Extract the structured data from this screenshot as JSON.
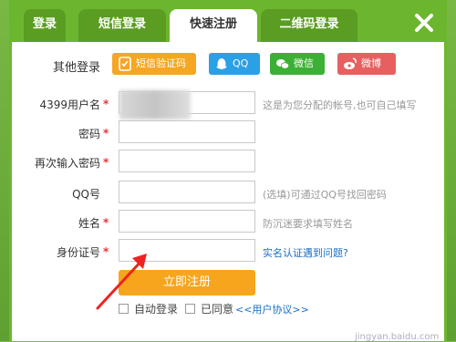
{
  "tabs": [
    {
      "label": "登录",
      "active": false
    },
    {
      "label": "短信登录",
      "active": false
    },
    {
      "label": "快速注册",
      "active": true
    },
    {
      "label": "二维码登录",
      "active": false
    }
  ],
  "close_icon": "close-icon",
  "other_login": {
    "label": "其他登录",
    "buttons": [
      {
        "label": "短信验证码",
        "icon": "sms-icon",
        "color": "#f5a623"
      },
      {
        "label": "QQ",
        "icon": "qq-icon",
        "color": "#2aa0e6"
      },
      {
        "label": "微信",
        "icon": "wechat-icon",
        "color": "#3cb034"
      },
      {
        "label": "微博",
        "icon": "weibo-icon",
        "color": "#e85f5f"
      }
    ]
  },
  "form": {
    "username": {
      "label": "4399用户名",
      "hint": "这是为您分配的帐号,也可自己填写",
      "required": true
    },
    "password": {
      "label": "密码",
      "required": true
    },
    "confirm_password": {
      "label": "再次输入密码",
      "required": true
    },
    "qq": {
      "label": "QQ号",
      "hint": "(选填)可通过QQ号找回密码",
      "required": false
    },
    "name": {
      "label": "姓名",
      "hint": "防沉迷要求填写姓名",
      "required": true
    },
    "id_card": {
      "label": "身份证号",
      "hint": "实名认证遇到问题?",
      "required": true
    },
    "required_mark": "*"
  },
  "submit_label": "立即注册",
  "auto_login": {
    "label": "自动登录",
    "checked": false
  },
  "agree": {
    "label": "已同意",
    "checked": false,
    "link": "<<用户协议>>"
  },
  "watermark": "jingyan.baidu.com",
  "colors": {
    "accent": "#6bb62e",
    "submit": "#f7a51c",
    "link": "#1a6fc4",
    "required": "#e33333"
  }
}
